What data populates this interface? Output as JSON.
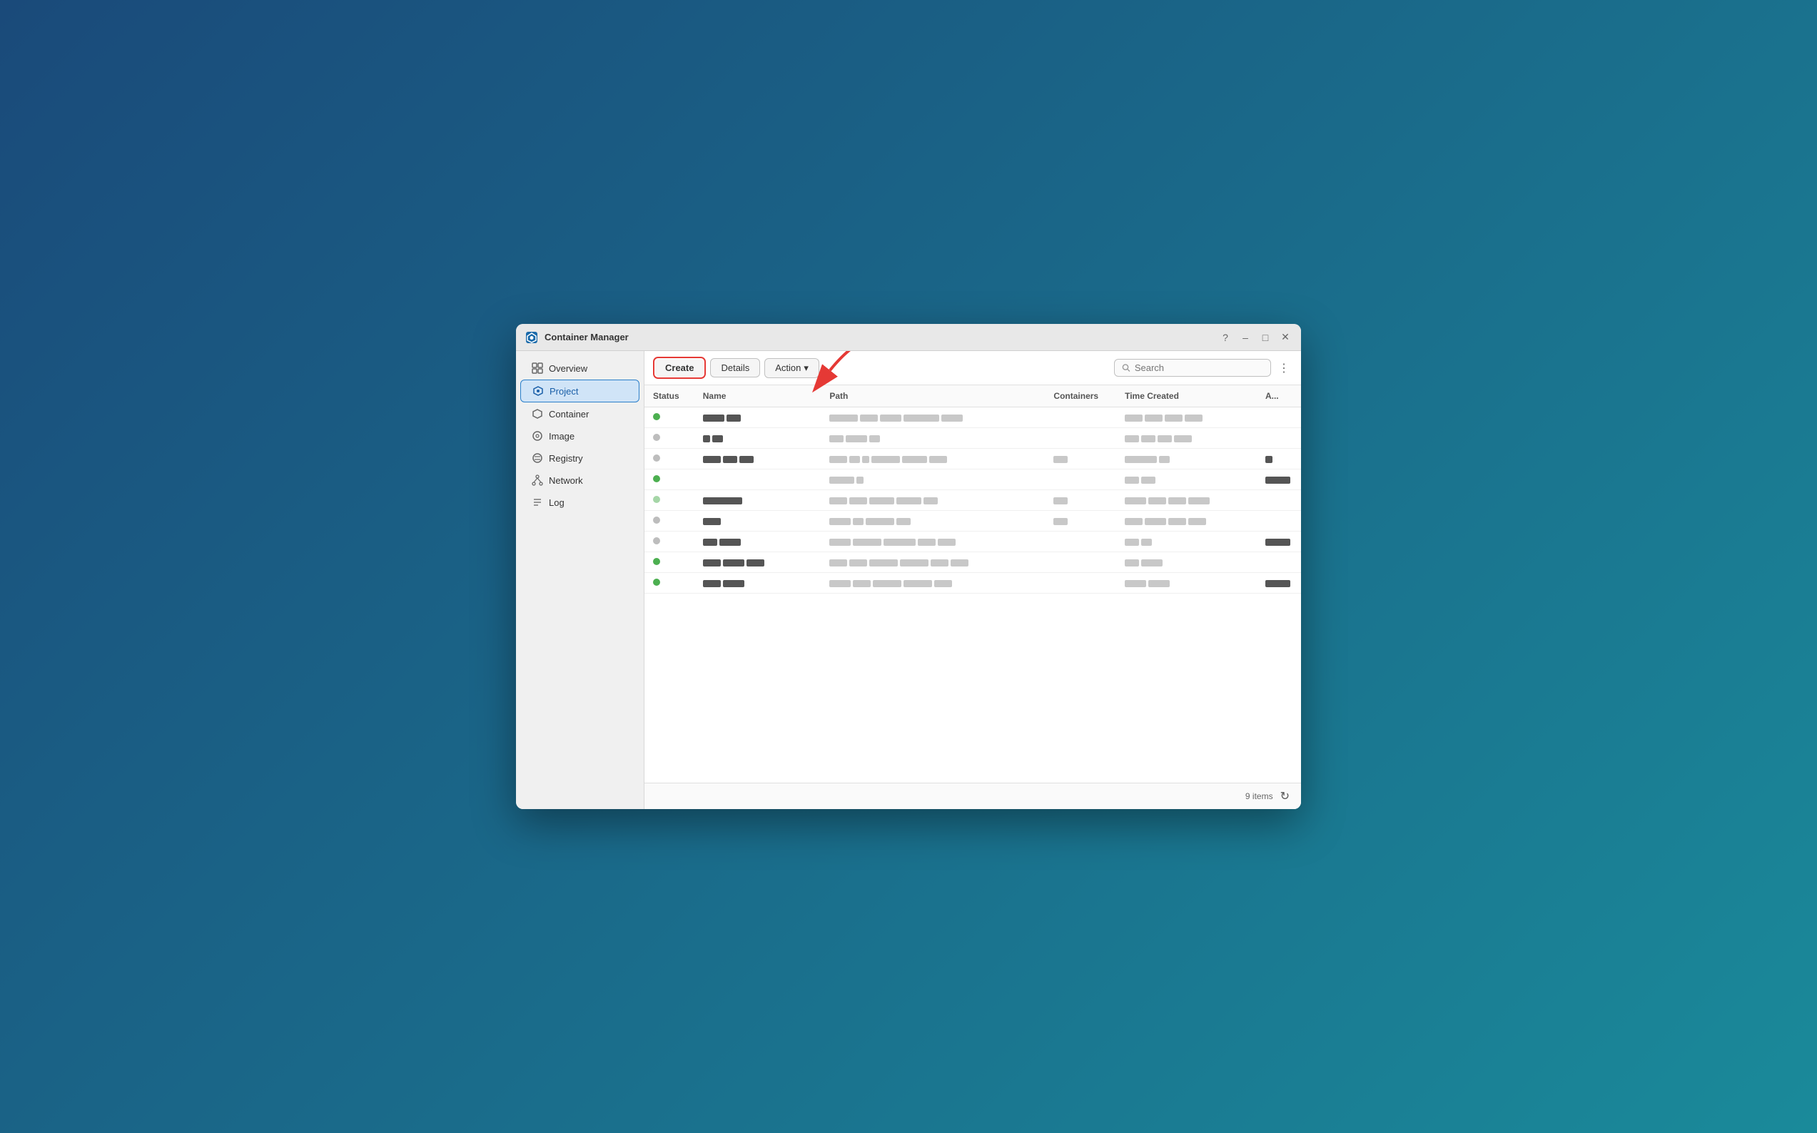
{
  "window": {
    "title": "Container Manager",
    "icon": "container-manager-icon"
  },
  "titlebar": {
    "controls": [
      "help",
      "minimize",
      "maximize",
      "close"
    ]
  },
  "sidebar": {
    "items": [
      {
        "id": "overview",
        "label": "Overview",
        "icon": "grid-icon",
        "active": false
      },
      {
        "id": "project",
        "label": "Project",
        "icon": "project-icon",
        "active": true
      },
      {
        "id": "container",
        "label": "Container",
        "icon": "container-icon",
        "active": false
      },
      {
        "id": "image",
        "label": "Image",
        "icon": "image-icon",
        "active": false
      },
      {
        "id": "registry",
        "label": "Registry",
        "icon": "registry-icon",
        "active": false
      },
      {
        "id": "network",
        "label": "Network",
        "icon": "network-icon",
        "active": false
      },
      {
        "id": "log",
        "label": "Log",
        "icon": "log-icon",
        "active": false
      }
    ]
  },
  "toolbar": {
    "create_label": "Create",
    "details_label": "Details",
    "action_label": "Action",
    "search_placeholder": "Search"
  },
  "table": {
    "columns": [
      "Status",
      "Name",
      "Path",
      "Containers",
      "Time Created",
      "A..."
    ],
    "rows": [
      {
        "status": "green",
        "name": "████ ██",
        "path": "██████ ██ ███ ████████ ███",
        "containers": "",
        "time": "████ ███ ██ ████",
        "extra": ""
      },
      {
        "status": "gray",
        "name": "█ ██",
        "path": "██ ████ ██",
        "containers": "",
        "time": "███ ██ ██ ████",
        "extra": ""
      },
      {
        "status": "gray",
        "name": "████ ███ ███",
        "path": "███ ██ █ ████████ ████████ ███",
        "containers": "██",
        "time": "████████ ██",
        "extra": "█"
      },
      {
        "status": "green",
        "name": "",
        "path": "████ █",
        "containers": "",
        "time": "██ ██",
        "extra": "████"
      },
      {
        "status": "light-green",
        "name": "████████",
        "path": "███ ███ ████ ████████ ███",
        "containers": "██",
        "time": "████ ████ ████ ████",
        "extra": ""
      },
      {
        "status": "gray",
        "name": "████",
        "path": "████ ██ ████████ ███",
        "containers": "██",
        "time": "███ ████ ████ ████",
        "extra": ""
      },
      {
        "status": "gray",
        "name": "███ █████",
        "path": "████ ████████ ████████ ████ ████",
        "containers": "",
        "time": "███ ██",
        "extra": "████"
      },
      {
        "status": "green",
        "name": "████ ████ ████",
        "path": "███ ███ ████████ ████████ ████ ████",
        "containers": "",
        "time": "███ ████",
        "extra": ""
      },
      {
        "status": "green",
        "name": "████ █████",
        "path": "████ ███ ████████ ████████ ████",
        "containers": "",
        "time": "████ ████",
        "extra": "████"
      }
    ]
  },
  "footer": {
    "count_label": "9 items",
    "refresh_icon": "refresh-icon"
  }
}
